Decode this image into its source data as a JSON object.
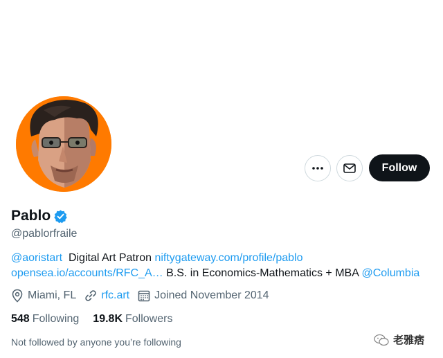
{
  "profile": {
    "display_name": "Pablo",
    "handle": "@pablorfraile",
    "verified": true
  },
  "actions": {
    "more_icon": "more-dots-icon",
    "message_icon": "envelope-icon",
    "follow_label": "Follow"
  },
  "bio": {
    "mention_aori": "@aoristart",
    "text_patron": "Digital Art Patron",
    "link_nifty": "niftygateway.com/profile/pablo",
    "link_opensea": "opensea.io/accounts/RFC_A…",
    "text_degree": "B.S. in Economics-Mathematics + MBA",
    "mention_columbia": "@Columbia"
  },
  "meta": {
    "location": "Miami, FL",
    "website": "rfc.art",
    "joined": "Joined November 2014"
  },
  "stats": {
    "following_count": "548",
    "following_label": "Following",
    "followers_count": "19.8K",
    "followers_label": "Followers"
  },
  "not_followed_text": "Not followed by anyone you’re following",
  "watermark": {
    "text": "老雅痞"
  },
  "colors": {
    "accent": "#1d9bf0",
    "text": "#0f1419",
    "secondary": "#536471",
    "avatar_bg": "#ff7a00"
  }
}
